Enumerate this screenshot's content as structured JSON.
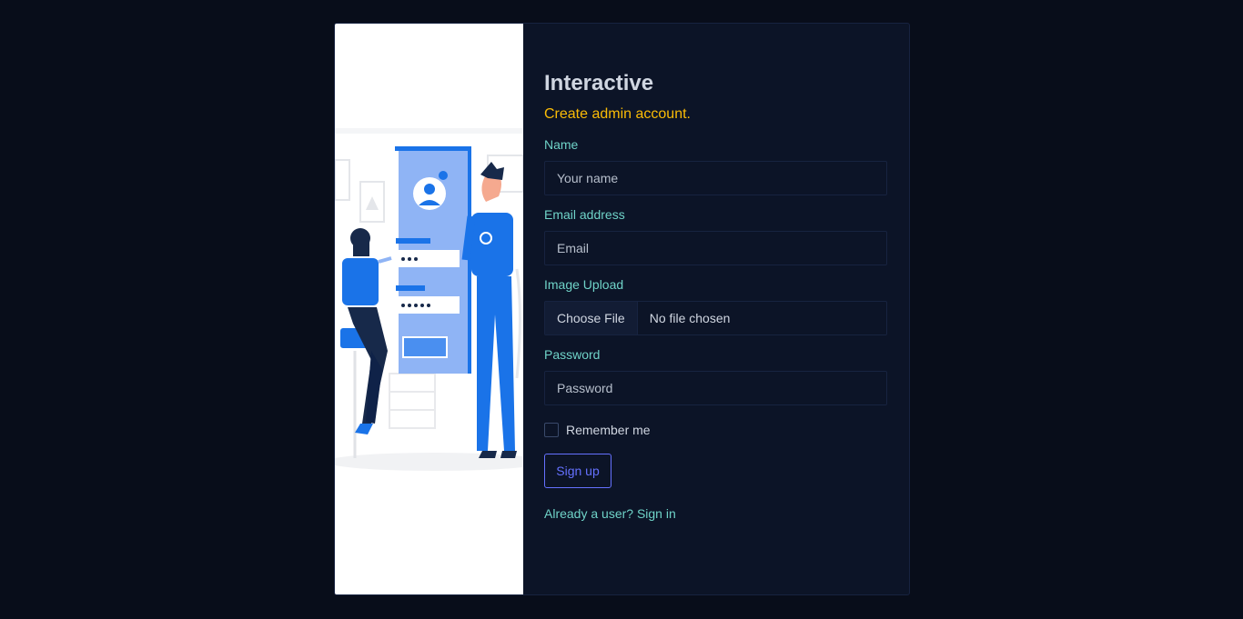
{
  "brand": "Interactive",
  "subtitle": "Create admin account.",
  "fields": {
    "name": {
      "label": "Name",
      "placeholder": "Your name"
    },
    "email": {
      "label": "Email address",
      "placeholder": "Email"
    },
    "image": {
      "label": "Image Upload",
      "button": "Choose File",
      "status": "No file chosen"
    },
    "password": {
      "label": "Password",
      "placeholder": "Password"
    }
  },
  "remember_label": "Remember me",
  "signup_label": "Sign up",
  "signin_link": "Already a user? Sign in",
  "colors": {
    "page_bg": "#080d1a",
    "card_bg": "#0c1427",
    "label": "#6fd3c8",
    "subtitle": "#fbbc06",
    "primary": "#6571ff",
    "illustration_blue": "#1a73e8"
  }
}
